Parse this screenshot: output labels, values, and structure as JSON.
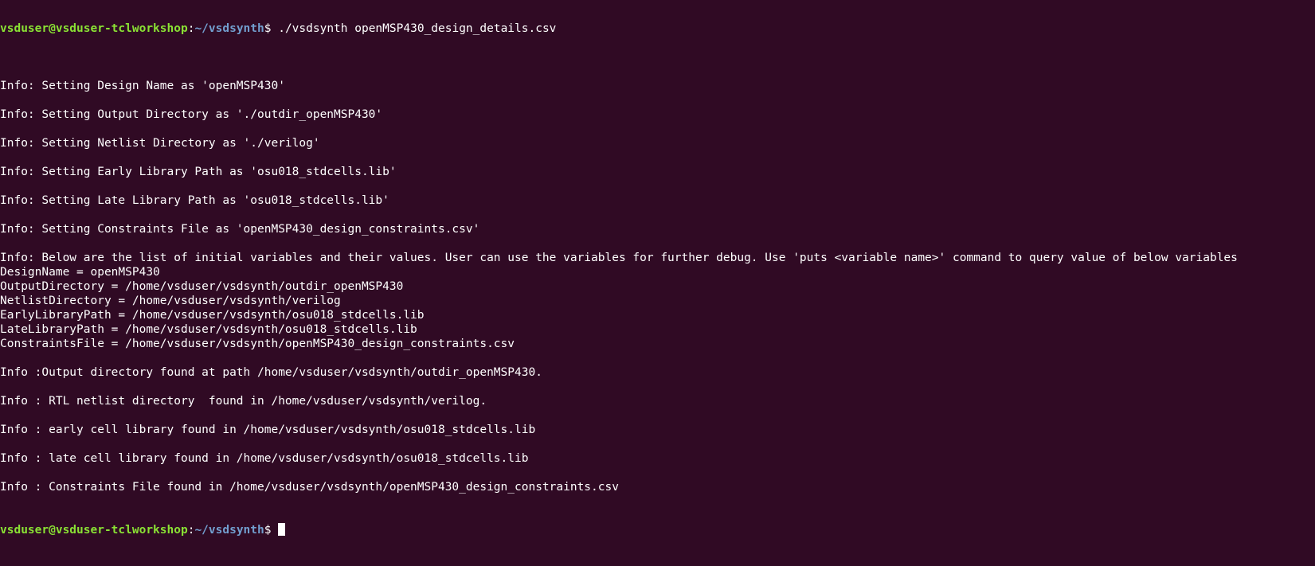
{
  "window": {
    "app": "Terminal"
  },
  "prompt": {
    "user_host": "vsduser@vsduser-tclworkshop",
    "colon": ":",
    "path": "~/vsdsynth",
    "symbol": "$ "
  },
  "command": "./vsdsynth openMSP430_design_details.csv",
  "output": [
    "",
    "Info: Setting Design Name as 'openMSP430'",
    "",
    "Info: Setting Output Directory as './outdir_openMSP430'",
    "",
    "Info: Setting Netlist Directory as './verilog'",
    "",
    "Info: Setting Early Library Path as 'osu018_stdcells.lib'",
    "",
    "Info: Setting Late Library Path as 'osu018_stdcells.lib'",
    "",
    "Info: Setting Constraints File as 'openMSP430_design_constraints.csv'",
    "",
    "Info: Below are the list of initial variables and their values. User can use the variables for further debug. Use 'puts <variable name>' command to query value of below variables",
    "DesignName = openMSP430",
    "OutputDirectory = /home/vsduser/vsdsynth/outdir_openMSP430",
    "NetlistDirectory = /home/vsduser/vsdsynth/verilog",
    "EarlyLibraryPath = /home/vsduser/vsdsynth/osu018_stdcells.lib",
    "LateLibraryPath = /home/vsduser/vsdsynth/osu018_stdcells.lib",
    "ConstraintsFile = /home/vsduser/vsdsynth/openMSP430_design_constraints.csv",
    "",
    "Info :Output directory found at path /home/vsduser/vsdsynth/outdir_openMSP430.",
    "",
    "Info : RTL netlist directory  found in /home/vsduser/vsdsynth/verilog.",
    "",
    "Info : early cell library found in /home/vsduser/vsdsynth/osu018_stdcells.lib",
    "",
    "Info : late cell library found in /home/vsduser/vsdsynth/osu018_stdcells.lib",
    "",
    "Info : Constraints File found in /home/vsduser/vsdsynth/openMSP430_design_constraints.csv"
  ],
  "colors": {
    "background": "#300a24",
    "text": "#ffffff",
    "prompt_user": "#8ae234",
    "prompt_path": "#729fcf"
  }
}
